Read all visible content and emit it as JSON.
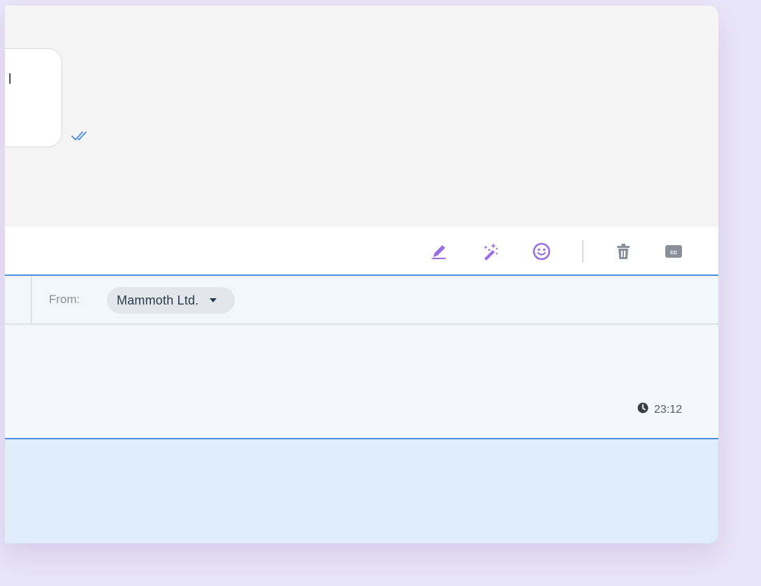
{
  "thread": {
    "bubble_text": "l",
    "read_status_icon": "double-check-icon"
  },
  "toolbar": {
    "icons": [
      "pen-icon",
      "magic-wand-icon",
      "emoji-icon",
      "trash-icon",
      "cc-icon"
    ],
    "cc_label": "cc",
    "accent_color": "#9b6ee6",
    "muted_color": "#8a9099"
  },
  "from": {
    "label": "From:",
    "value": "Mammoth Ltd."
  },
  "compose": {
    "time": "23:12",
    "time_icon": "clock-icon"
  },
  "colors": {
    "divider_accent": "#4a90e2",
    "background": "#e9e5f8",
    "footer": "#dfedfa"
  }
}
